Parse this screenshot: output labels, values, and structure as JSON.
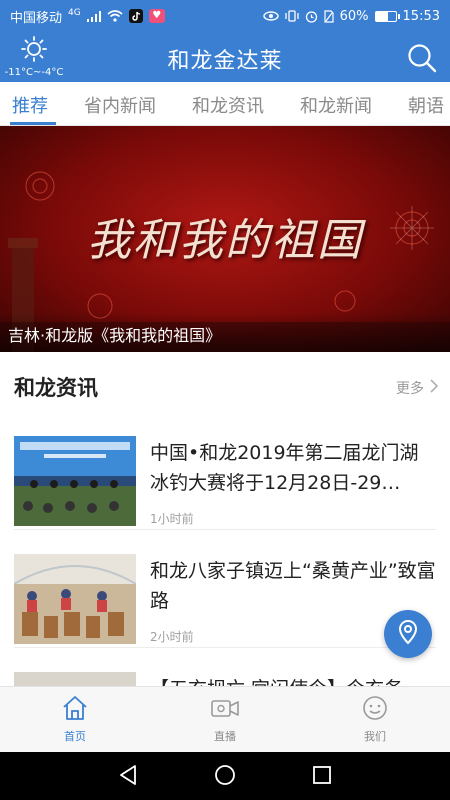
{
  "status_bar": {
    "carrier": "中国移动",
    "network": "4G",
    "battery": "60%",
    "battery_level": 0.6,
    "time": "15:53"
  },
  "header": {
    "title": "和龙金达莱",
    "weather_temp": "-11°C~-4°C"
  },
  "tabs": [
    {
      "label": "推荐",
      "active": true
    },
    {
      "label": "省内新闻",
      "active": false
    },
    {
      "label": "和龙资讯",
      "active": false
    },
    {
      "label": "和龙新闻",
      "active": false
    },
    {
      "label": "朝语",
      "active": false
    }
  ],
  "banner": {
    "image_text": "我和我的祖国",
    "caption": "吉林·和龙版《我和我的祖国》"
  },
  "section": {
    "title": "和龙资讯",
    "more": "更多"
  },
  "news": [
    {
      "title": "中国•和龙2019年第二届龙门湖冰钓大赛将于12月28日-29…",
      "time": "1小时前"
    },
    {
      "title": "和龙八家子镇迈上“桑黄产业”致富路",
      "time": "2小时前"
    }
  ],
  "partial_news": {
    "title": "【五玄坝亡 宫闪使今】今玄务"
  },
  "bottom_nav": [
    {
      "label": "首页",
      "icon": "home-icon",
      "active": true
    },
    {
      "label": "直播",
      "icon": "video-camera-icon",
      "active": false
    },
    {
      "label": "我们",
      "icon": "smiley-icon",
      "active": false
    }
  ],
  "colors": {
    "primary": "#3a7fd1",
    "banner_red": "#b01814"
  }
}
